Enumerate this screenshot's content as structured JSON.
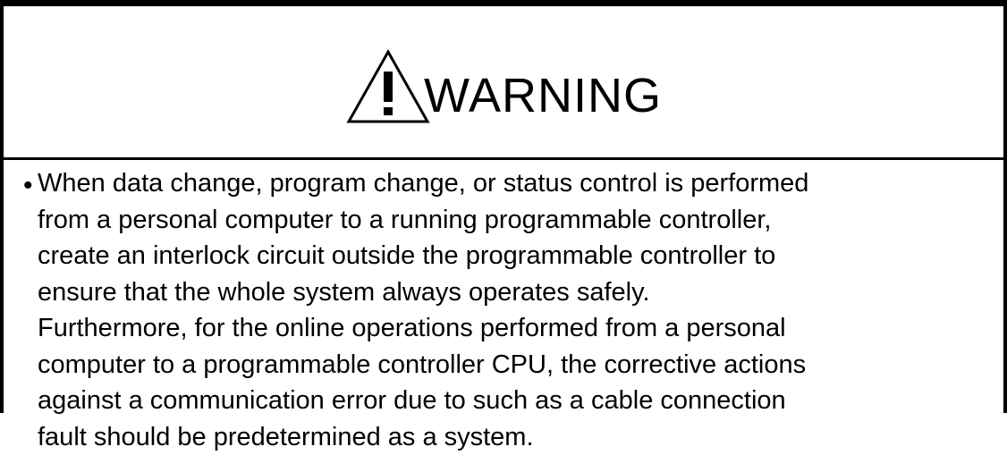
{
  "warning": {
    "icon": "warning-triangle-icon",
    "title": "WARNING"
  },
  "item": {
    "bullet": "•",
    "lines": [
      "When data change, program change, or status control is performed",
      "from a personal computer to a running programmable controller,",
      "create an interlock circuit outside the programmable controller to",
      "ensure that the whole system always operates safely.",
      "Furthermore, for the online operations performed from a personal",
      "computer to a programmable controller CPU, the corrective actions",
      "against a communication error due to such as a cable connection",
      "fault should be predetermined as a system."
    ]
  }
}
